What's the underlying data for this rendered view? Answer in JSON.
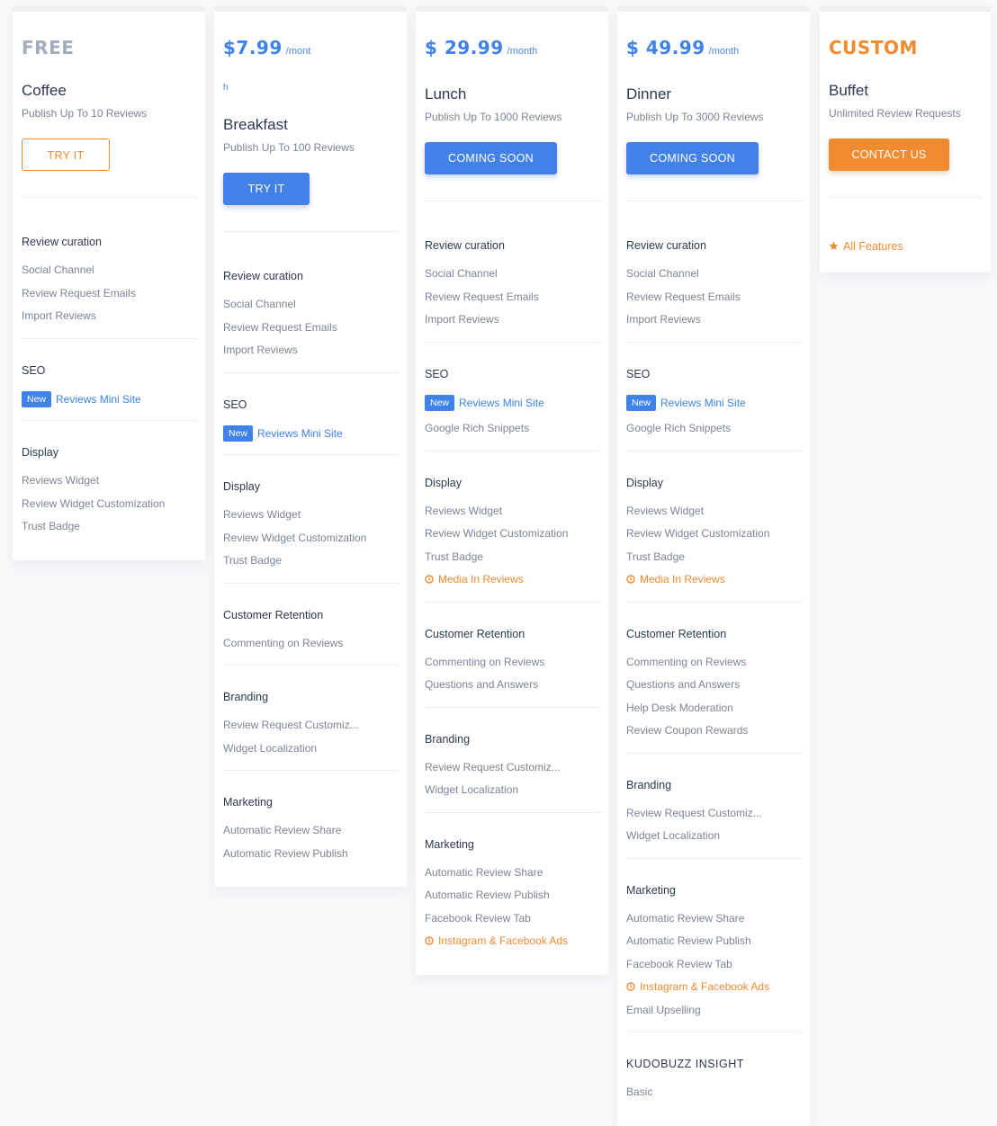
{
  "colors": {
    "blue": "#3e82ea",
    "orange": "#f08b32",
    "grey_price": "#a3adbb"
  },
  "plans": [
    {
      "price": "FREE",
      "per": "",
      "name": "Coffee",
      "desc": "Publish Up To 10 Reviews",
      "button": "TRY IT",
      "sections": [
        {
          "title": "Review curation",
          "features": [
            "Social Channel",
            "Review Request Emails",
            "Import Reviews"
          ]
        },
        {
          "title": "SEO",
          "badge": "New",
          "badge_feature": "Reviews Mini Site",
          "features": []
        },
        {
          "title": "Display",
          "features": [
            "Reviews Widget",
            "Review Widget Customization",
            "Trust Badge"
          ]
        }
      ]
    },
    {
      "price": "$7.99",
      "per": "/mont",
      "per_wrap": "h",
      "name": "Breakfast",
      "desc": "Publish Up To 100 Reviews",
      "button": "TRY IT",
      "sections": [
        {
          "title": "Review curation",
          "features": [
            "Social Channel",
            "Review Request Emails",
            "Import Reviews"
          ]
        },
        {
          "title": "SEO",
          "badge": "New",
          "badge_feature": "Reviews Mini Site",
          "features": []
        },
        {
          "title": "Display",
          "features": [
            "Reviews Widget",
            "Review Widget Customization",
            "Trust Badge"
          ]
        },
        {
          "title": "Customer Retention",
          "features": [
            "Commenting on Reviews"
          ]
        },
        {
          "title": "Branding",
          "features": [
            "Review Request Customiz...",
            "Widget Localization"
          ]
        },
        {
          "title": "Marketing",
          "features": [
            "Automatic Review Share",
            "Automatic Review Publish"
          ]
        }
      ]
    },
    {
      "price": "$ 29.99",
      "per": "/month",
      "name": "Lunch",
      "desc": "Publish Up To 1000 Reviews",
      "button": "COMING SOON",
      "sections": [
        {
          "title": "Review curation",
          "features": [
            "Social Channel",
            "Review Request Emails",
            "Import Reviews"
          ]
        },
        {
          "title": "SEO",
          "badge": "New",
          "badge_feature": "Reviews Mini Site",
          "features": [
            "Google Rich Snippets"
          ]
        },
        {
          "title": "Display",
          "features": [
            "Reviews Widget",
            "Review Widget Customization",
            "Trust Badge"
          ],
          "soon": "Media In Reviews"
        },
        {
          "title": "Customer Retention",
          "features": [
            "Commenting on Reviews",
            "Questions and Answers"
          ]
        },
        {
          "title": "Branding",
          "features": [
            "Review Request Customiz...",
            "Widget Localization"
          ]
        },
        {
          "title": "Marketing",
          "features": [
            "Automatic Review Share",
            "Automatic Review Publish",
            "Facebook Review Tab"
          ],
          "soon": "Instagram & Facebook Ads"
        }
      ]
    },
    {
      "price": "$ 49.99",
      "per": "/month",
      "name": "Dinner",
      "desc": "Publish Up To 3000 Reviews",
      "button": "COMING SOON",
      "sections": [
        {
          "title": "Review curation",
          "features": [
            "Social Channel",
            "Review Request Emails",
            "Import Reviews"
          ]
        },
        {
          "title": "SEO",
          "badge": "New",
          "badge_feature": "Reviews Mini Site",
          "features": [
            "Google Rich Snippets"
          ]
        },
        {
          "title": "Display",
          "features": [
            "Reviews Widget",
            "Review Widget Customization",
            "Trust Badge"
          ],
          "soon": "Media In Reviews"
        },
        {
          "title": "Customer Retention",
          "features": [
            "Commenting on Reviews",
            "Questions and Answers",
            "Help Desk Moderation",
            "Review Coupon Rewards"
          ]
        },
        {
          "title": "Branding",
          "features": [
            "Review Request Customiz...",
            "Widget Localization"
          ]
        },
        {
          "title": "Marketing",
          "features": [
            "Automatic Review Share",
            "Automatic Review Publish",
            "Facebook Review Tab"
          ],
          "soon": "Instagram & Facebook Ads",
          "after": [
            "Email Upselling"
          ]
        },
        {
          "title": "KUDOBUZZ INSIGHT",
          "features": [
            "Basic"
          ]
        }
      ]
    },
    {
      "price": "CUSTOM",
      "per": "",
      "name": "Buffet",
      "desc": "Unlimited Review Requests",
      "button": "CONTACT US",
      "all_features": "All Features"
    }
  ]
}
